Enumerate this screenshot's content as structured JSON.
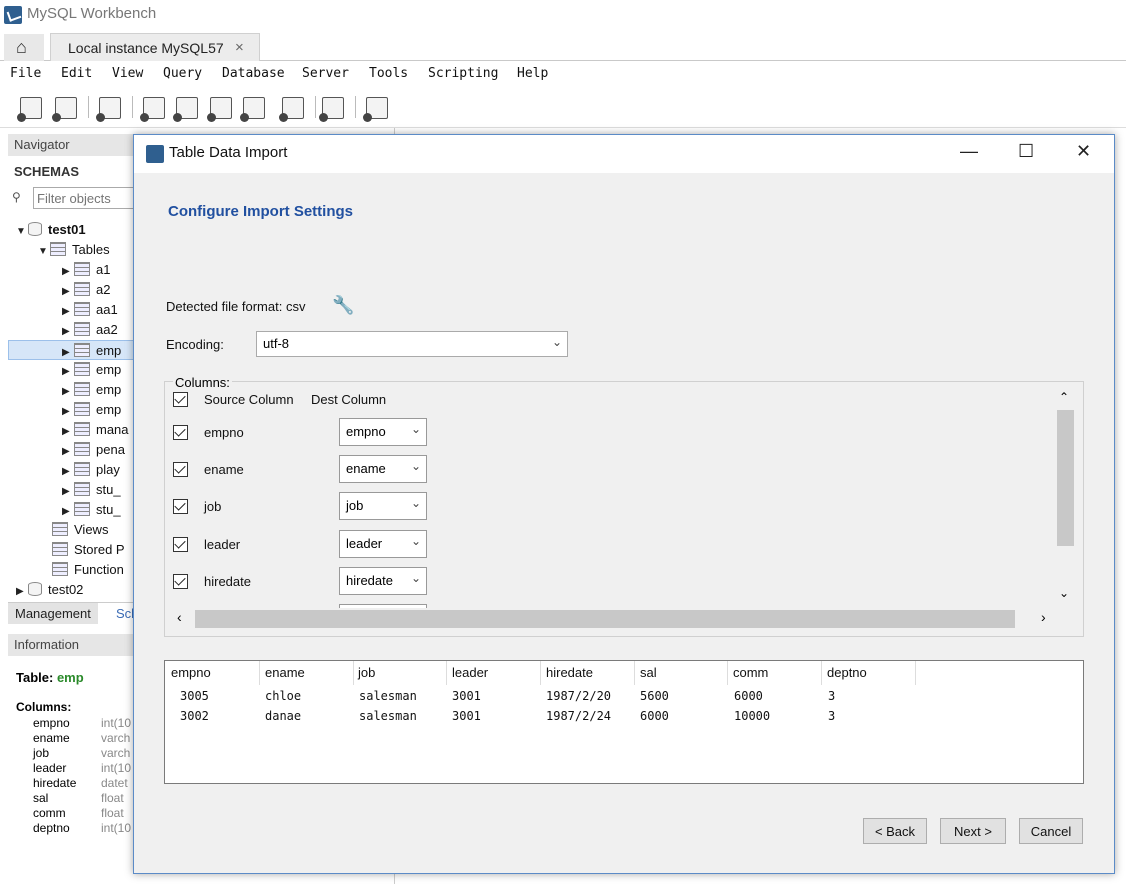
{
  "app": {
    "title": "MySQL Workbench"
  },
  "tabs": {
    "home_icon": "home-icon",
    "active_tab": "Local instance MySQL57",
    "close": "×"
  },
  "menu": [
    "File",
    "Edit",
    "View",
    "Query",
    "Database",
    "Server",
    "Tools",
    "Scripting",
    "Help"
  ],
  "navigator": {
    "header": "Navigator",
    "schemas_label": "SCHEMAS",
    "filter_placeholder": "Filter objects",
    "schema1": "test01",
    "tables_label": "Tables",
    "tables": [
      "a1",
      "a2",
      "aa1",
      "aa2",
      "emp",
      "emp",
      "emp",
      "emp",
      "mana",
      "pena",
      "play",
      "stu_",
      "stu_"
    ],
    "views_label": "Views",
    "stored_label": "Stored P",
    "functions_label": "Function",
    "schema2": "test02"
  },
  "bottom_tabs": {
    "management": "Management",
    "schemas": "Sch"
  },
  "information": {
    "header": "Information",
    "table_prefix": "Table:",
    "table_name": "emp",
    "columns_label": "Columns:",
    "columns": [
      {
        "name": "empno",
        "type": "int(10"
      },
      {
        "name": "ename",
        "type": "varch"
      },
      {
        "name": "job",
        "type": "varch"
      },
      {
        "name": "leader",
        "type": "int(10"
      },
      {
        "name": "hiredate",
        "type": "datet"
      },
      {
        "name": "sal",
        "type": "float"
      },
      {
        "name": "comm",
        "type": "float"
      },
      {
        "name": "deptno",
        "type": "int(10"
      }
    ]
  },
  "dialog": {
    "title": "Table Data Import",
    "minimize": "—",
    "maximize": "☐",
    "close": "✕",
    "heading": "Configure Import Settings",
    "detected_format": "Detected file format: csv",
    "encoding_label": "Encoding:",
    "encoding_value": "utf-8",
    "columns_legend": "Columns:",
    "source_header": "Source Column",
    "dest_header": "Dest Column",
    "mappings": [
      {
        "source": "empno",
        "dest": "empno"
      },
      {
        "source": "ename",
        "dest": "ename"
      },
      {
        "source": "job",
        "dest": "job"
      },
      {
        "source": "leader",
        "dest": "leader"
      },
      {
        "source": "hiredate",
        "dest": "hiredate"
      }
    ],
    "preview_headers": [
      "empno",
      "ename",
      "job",
      "leader",
      "hiredate",
      "sal",
      "comm",
      "deptno"
    ],
    "preview_rows": [
      [
        "3005",
        "chloe",
        "salesman",
        "3001",
        "1987/2/20",
        "5600",
        "6000",
        "3"
      ],
      [
        "3002",
        "danae",
        "salesman",
        "3001",
        "1987/2/24",
        "6000",
        "10000",
        "3"
      ]
    ],
    "back_label": "< Back",
    "next_label": "Next >",
    "cancel_label": "Cancel"
  }
}
